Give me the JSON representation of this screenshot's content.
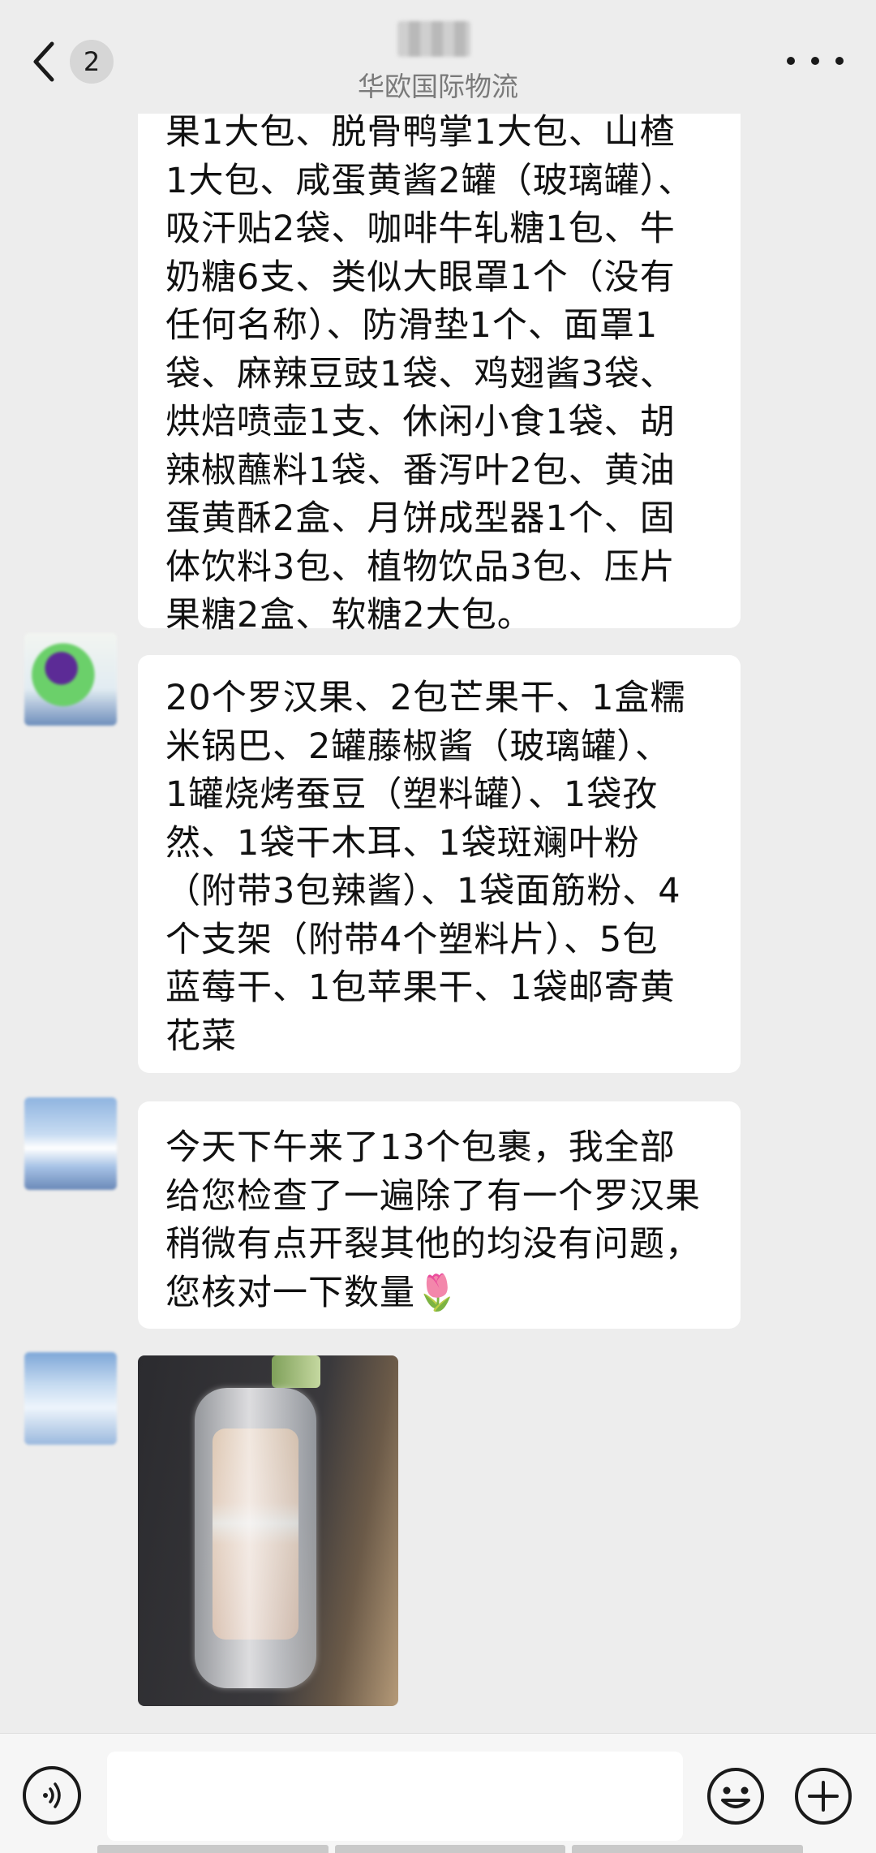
{
  "header": {
    "unread_count": "2",
    "subtitle": "华欧国际物流"
  },
  "messages": [
    {
      "type": "text",
      "lines": [
        "果1大包、脱骨鸭掌1大包、山楂",
        "1大包、咸蛋黄酱2罐（玻璃罐）、",
        "吸汗贴2袋、咖啡牛轧糖1包、牛",
        "奶糖6支、类似大眼罩1个（没有",
        "任何名称）、防滑垫1个、面罩1",
        "袋、麻辣豆豉1袋、鸡翅酱3袋、",
        "烘焙喷壶1支、休闲小食1袋、胡",
        "辣椒蘸料1袋、番泻叶2包、黄油",
        "蛋黄酥2盒、月饼成型器1个、固",
        "体饮料3包、植物饮品3包、压片",
        "果糖2盒、软糖2大包。"
      ]
    },
    {
      "type": "text",
      "lines": [
        "20个罗汉果、2包芒果干、1盒糯",
        "米锅巴、2罐藤椒酱（玻璃罐）、",
        "1罐烧烤蚕豆（塑料罐）、1袋孜",
        "然、1袋干木耳、1袋斑斓叶粉",
        "（附带3包辣酱）、1袋面筋粉、4",
        "个支架（附带4个塑料片）、5包",
        "蓝莓干、1包苹果干、1袋邮寄黄",
        "花菜"
      ]
    },
    {
      "type": "text",
      "lines": [
        "今天下午来了13个包裹，我全部",
        "给您检查了一遍除了有一个罗汉果",
        "稍微有点开裂其他的均没有问题，",
        "您核对一下数量🌷"
      ]
    },
    {
      "type": "image"
    }
  ],
  "icons": {
    "back": "chevron-left-icon",
    "more": "more-dots-icon",
    "voice": "voice-icon",
    "emoji": "emoji-icon",
    "plus": "plus-icon"
  }
}
